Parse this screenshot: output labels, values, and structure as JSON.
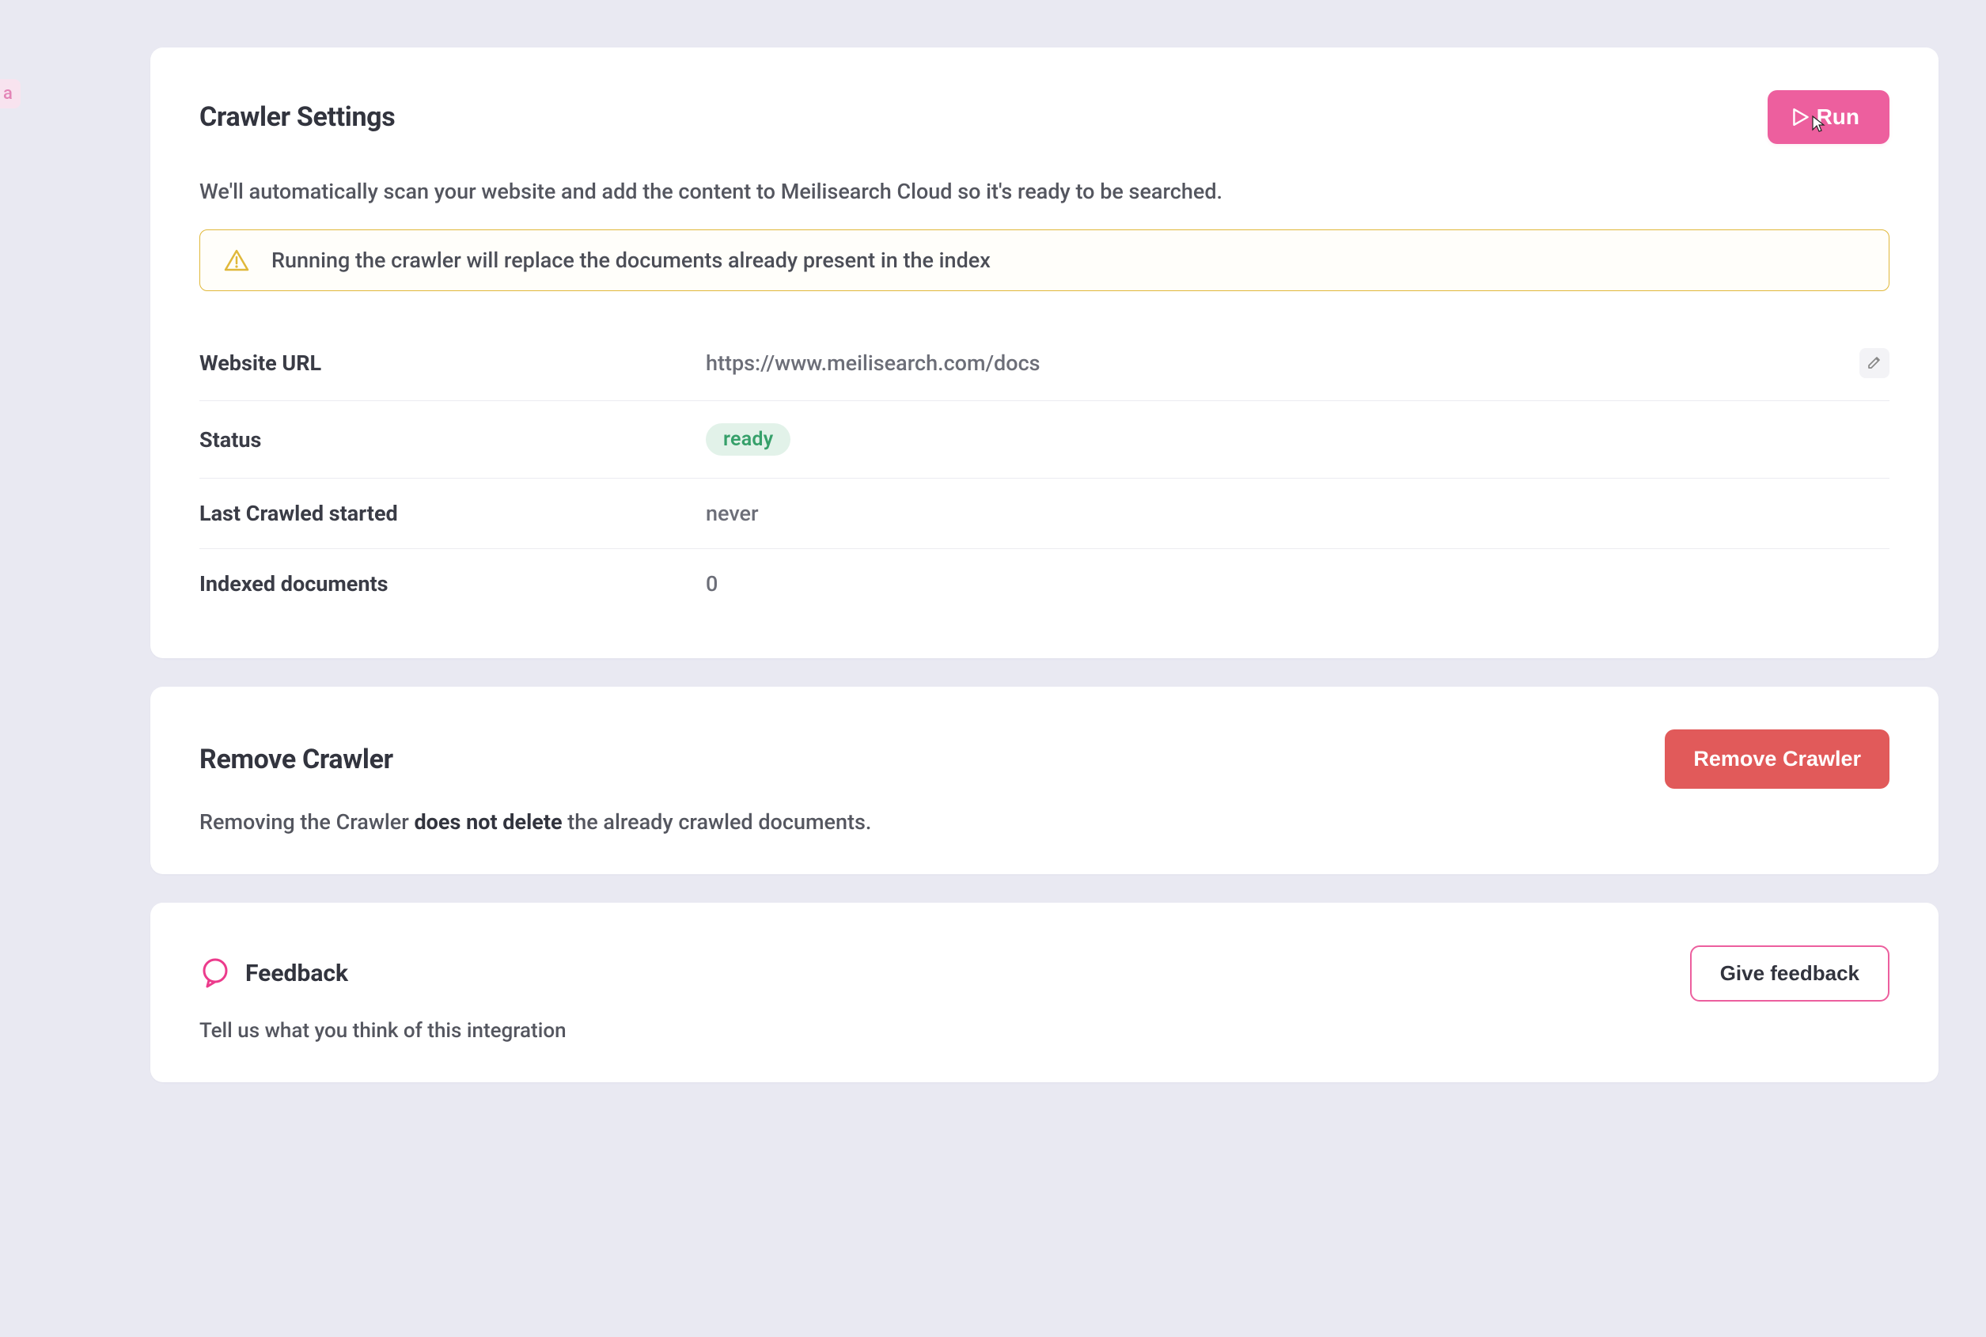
{
  "left_tag": "a",
  "crawler": {
    "title": "Crawler Settings",
    "run_label": "Run",
    "desc": "We'll automatically scan your website and add the content to Meilisearch Cloud so it's ready to be searched.",
    "alert": "Running the crawler will replace the documents already present in the index",
    "rows": {
      "website_url_label": "Website URL",
      "website_url_value": "https://www.meilisearch.com/docs",
      "status_label": "Status",
      "status_value": "ready",
      "last_crawled_label": "Last Crawled started",
      "last_crawled_value": "never",
      "indexed_label": "Indexed documents",
      "indexed_value": "0"
    }
  },
  "remove": {
    "title": "Remove Crawler",
    "button": "Remove Crawler",
    "desc_prefix": "Removing the Crawler ",
    "desc_bold": "does not delete",
    "desc_suffix": " the already crawled documents."
  },
  "feedback": {
    "title": "Feedback",
    "button": "Give feedback",
    "desc": "Tell us what you think of this integration"
  },
  "colors": {
    "accent_pink": "#ed5f9e",
    "danger_red": "#e15a5a",
    "status_green": "#36a06a",
    "warning_border": "#e0b83a",
    "bg": "#e9e9f2"
  }
}
